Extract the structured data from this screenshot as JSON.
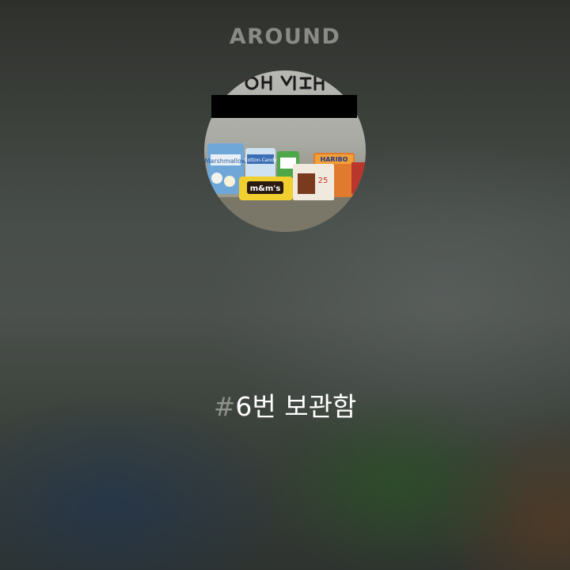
{
  "header": {
    "brand": "AROUND"
  },
  "profile": {
    "photo_handwriting": "6번 선물함",
    "candy_labels": [
      "Marshmallow",
      "Cotton-Candy",
      "m&m's",
      "HARIBO",
      "25"
    ]
  },
  "tag": {
    "hash": "#",
    "label": "6번 보관함"
  },
  "colors": {
    "brand_text": "#8a8b86",
    "hash": "#8d908b",
    "tag_text": "#ffffff"
  }
}
